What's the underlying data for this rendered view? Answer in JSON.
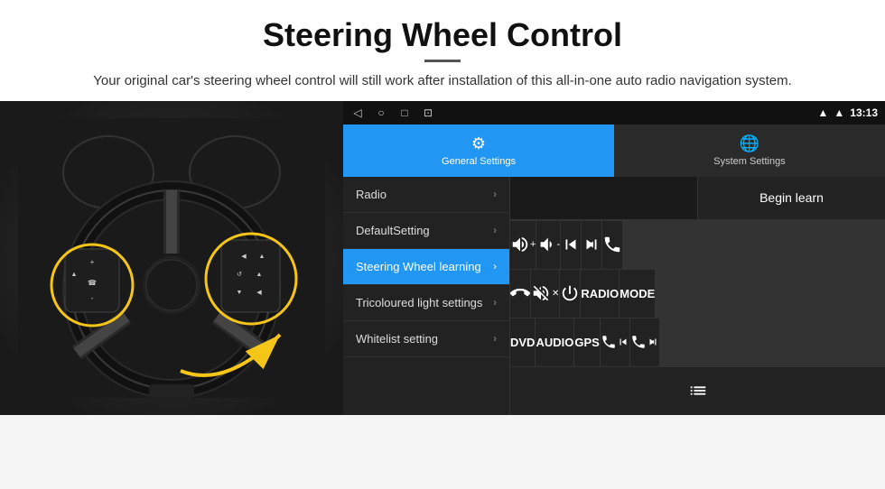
{
  "header": {
    "title": "Steering Wheel Control",
    "divider": true,
    "subtitle": "Your original car's steering wheel control will still work after installation of this all-in-one auto radio navigation system."
  },
  "statusBar": {
    "navButtons": [
      "◁",
      "○",
      "□",
      "⊡"
    ],
    "rightInfo": {
      "signal1": "▲",
      "signal2": "▲",
      "time": "13:13"
    }
  },
  "tabs": [
    {
      "id": "general",
      "label": "General Settings",
      "icon": "⚙",
      "active": true
    },
    {
      "id": "system",
      "label": "System Settings",
      "icon": "🌐",
      "active": false
    }
  ],
  "menu": {
    "items": [
      {
        "label": "Radio",
        "active": false
      },
      {
        "label": "DefaultSetting",
        "active": false
      },
      {
        "label": "Steering Wheel learning",
        "active": true
      },
      {
        "label": "Tricoloured light settings",
        "active": false
      },
      {
        "label": "Whitelist setting",
        "active": false
      }
    ]
  },
  "rightPanel": {
    "beginLearnLabel": "Begin learn",
    "buttons": [
      {
        "id": "vol-up",
        "label": "🔊+",
        "type": "icon"
      },
      {
        "id": "vol-down",
        "label": "🔉-",
        "type": "icon"
      },
      {
        "id": "prev-track",
        "label": "⏮",
        "type": "icon"
      },
      {
        "id": "next-track",
        "label": "⏭",
        "type": "icon"
      },
      {
        "id": "phone-answer",
        "label": "📞",
        "type": "icon"
      },
      {
        "id": "hang-up",
        "label": "↩",
        "type": "icon"
      },
      {
        "id": "mute",
        "label": "🔇",
        "type": "icon"
      },
      {
        "id": "power",
        "label": "⏻",
        "type": "icon"
      },
      {
        "id": "radio-btn",
        "label": "RADIO",
        "type": "text"
      },
      {
        "id": "mode-btn",
        "label": "MODE",
        "type": "text"
      },
      {
        "id": "dvd-btn",
        "label": "DVD",
        "type": "text"
      },
      {
        "id": "audio-btn",
        "label": "AUDIO",
        "type": "text"
      },
      {
        "id": "gps-btn",
        "label": "GPS",
        "type": "text"
      },
      {
        "id": "phone-prev",
        "label": "📞⏮",
        "type": "icon"
      },
      {
        "id": "phone-next",
        "label": "📞⏭",
        "type": "icon"
      },
      {
        "id": "unknown",
        "label": "≡",
        "type": "icon"
      }
    ]
  },
  "carImage": {
    "altText": "Steering wheel with highlighted controls"
  }
}
